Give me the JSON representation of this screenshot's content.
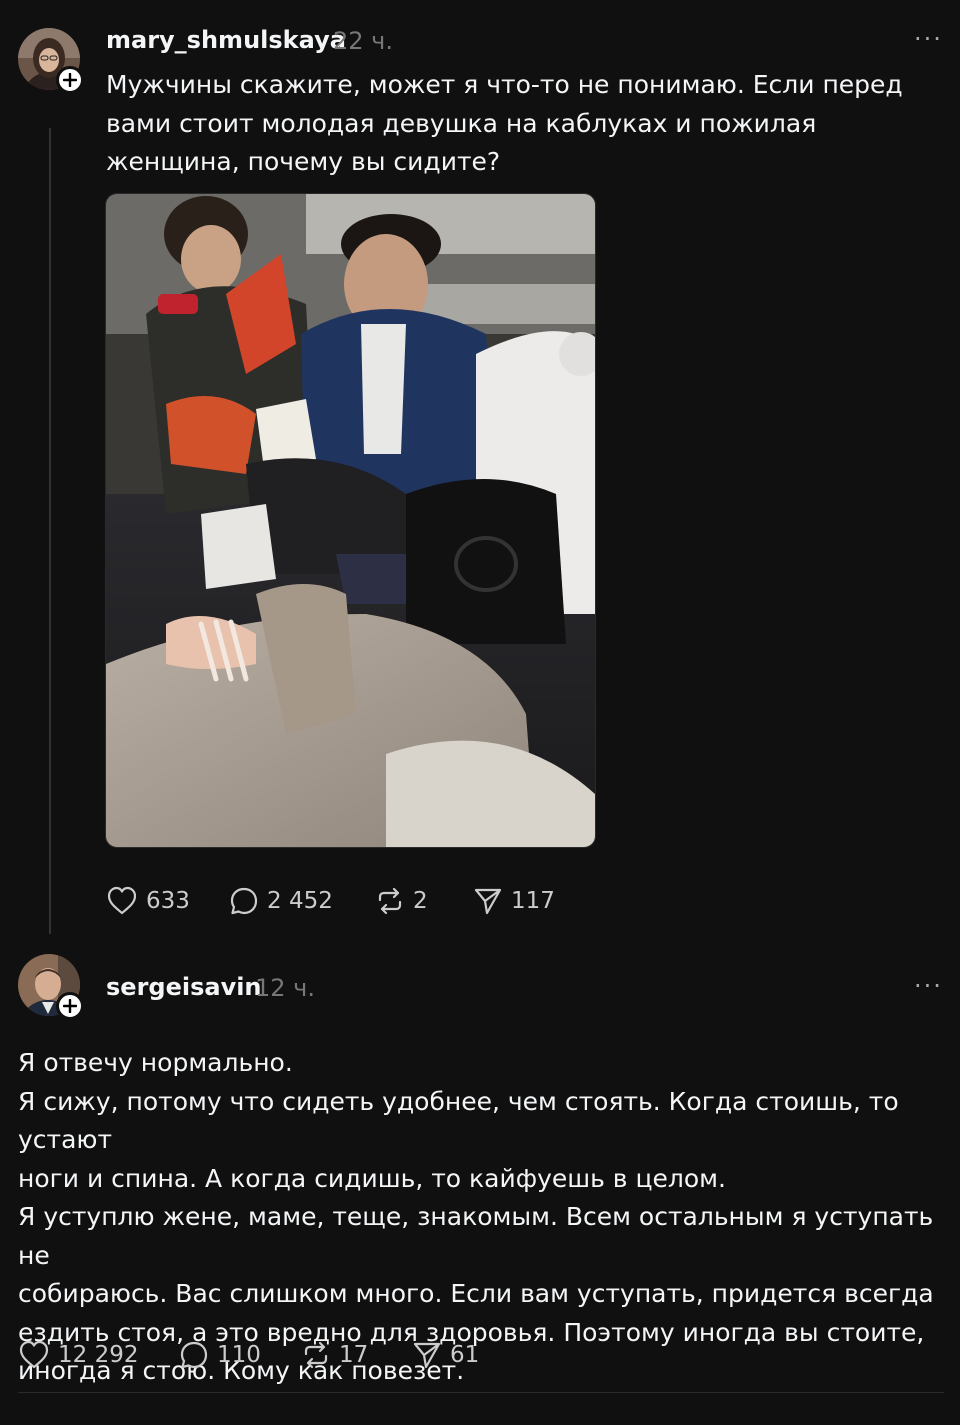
{
  "post": {
    "username": "mary_shmulskaya",
    "time": "22 ч.",
    "more": "···",
    "text": "Мужчины скажите, может я что-то не понимаю. Если перед вами стоит молодая девушка на каблуках и пожилая женщина, почему вы сидите?",
    "actions": {
      "likes": "633",
      "replies": "2 452",
      "reposts": "2",
      "shares": "117"
    }
  },
  "reply": {
    "username": "sergeisavin",
    "time": "12 ч.",
    "more": "···",
    "lines": [
      "Я отвечу нормально.",
      "Я сижу, потому что сидеть удобнее, чем стоять. Когда стоишь, то устают",
      "ноги и спина. А когда сидишь, то кайфуешь в целом.",
      "Я уступлю жене, маме, теще, знакомым. Всем остальным я уступать не",
      "собираюсь. Вас слишком много. Если вам уступать, придется всегда",
      "ездить стоя, а это вредно для здоровья. Поэтому иногда вы стоите,",
      "иногда я стою. Кому как повезет."
    ],
    "actions": {
      "likes": "12 292",
      "replies": "110",
      "reposts": "17",
      "shares": "61"
    }
  },
  "icons": {
    "like": "heart-icon",
    "reply": "speech-bubble-icon",
    "repost": "repost-icon",
    "share": "paper-plane-icon",
    "follow": "plus-icon",
    "more": "more-dots-icon"
  },
  "colors": {
    "background": "#101010",
    "text": "#f3f5f7",
    "secondary": "#777777",
    "divider": "#2a2a2a"
  }
}
